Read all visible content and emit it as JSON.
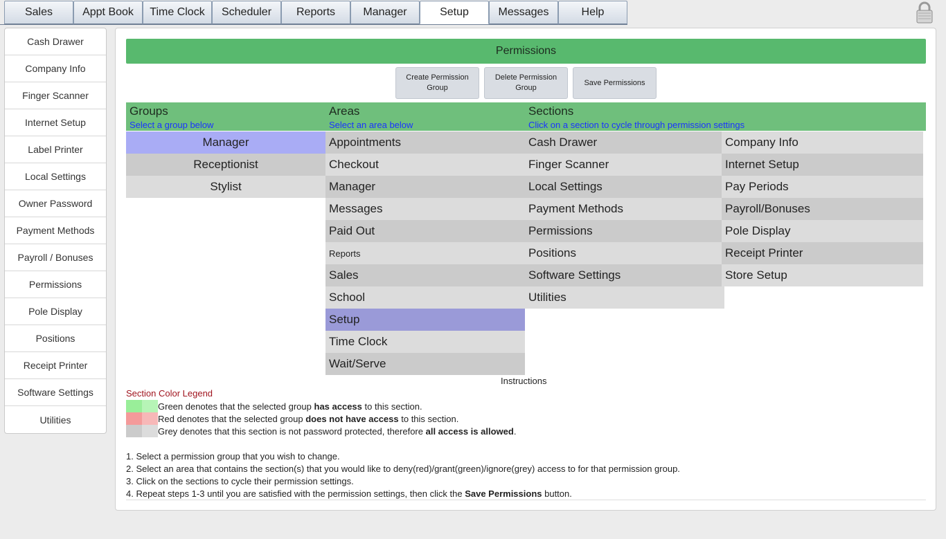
{
  "top_tabs": [
    "Sales",
    "Appt Book",
    "Time Clock",
    "Scheduler",
    "Reports",
    "Manager",
    "Setup",
    "Messages",
    "Help"
  ],
  "active_tab": "Setup",
  "sidebar": [
    "Cash Drawer",
    "Company Info",
    "Finger Scanner",
    "Internet Setup",
    "Label Printer",
    "Local Settings",
    "Owner Password",
    "Payment Methods",
    "Payroll / Bonuses",
    "Permissions",
    "Pole Display",
    "Positions",
    "Receipt Printer",
    "Software Settings",
    "Utilities"
  ],
  "header": {
    "title": "Permissions"
  },
  "buttons": {
    "create": "Create Permission Group",
    "delete": "Delete Permission Group",
    "save": "Save Permissions"
  },
  "columns": {
    "groups_title": "Groups",
    "groups_sub": "Select a group below",
    "areas_title": "Areas",
    "areas_sub": "Select an area below",
    "sections_title": "Sections",
    "sections_sub": "Click on a section to cycle through permission settings"
  },
  "groups": [
    "Manager",
    "Receptionist",
    "Stylist"
  ],
  "selected_group": "Manager",
  "areas": [
    "Appointments",
    "Checkout",
    "Manager",
    "Messages",
    "Paid Out",
    "Reports",
    "Sales",
    "School",
    "Setup",
    "Time Clock",
    "Wait/Serve"
  ],
  "selected_area": "Setup",
  "sections_left": [
    "Cash Drawer",
    "Finger Scanner",
    "Local Settings",
    "Payment Methods",
    "Permissions",
    "Positions",
    "Software Settings",
    "Utilities"
  ],
  "sections_right": [
    "Company Info",
    "Internet Setup",
    "Pay Periods",
    "Payroll/Bonuses",
    "Pole Display",
    "Receipt Printer",
    "Store Setup"
  ],
  "instructions_label": "Instructions",
  "legend": {
    "title": "Section Color Legend",
    "green": {
      "pre": "Green denotes that the selected group ",
      "bold": "has access",
      "post": " to this section.",
      "colors": [
        "#99ee99",
        "#b6f4b6"
      ]
    },
    "red": {
      "pre": "Red denotes that the selected group ",
      "bold": "does not have access",
      "post": " to this section.",
      "colors": [
        "#f49a9a",
        "#f7b8b8"
      ]
    },
    "grey": {
      "pre": "Grey denotes that this section is not password protected, therefore ",
      "bold": "all access is allowed",
      "post": ".",
      "colors": [
        "#cbcbcb",
        "#dcdcdc"
      ]
    }
  },
  "steps": [
    {
      "text": "1. Select a permission group that you wish to change."
    },
    {
      "text": "2. Select an area that contains the section(s) that you would like to deny(red)/grant(green)/ignore(grey) access to for that permission group."
    },
    {
      "text": "3. Click on the sections to cycle their permission settings."
    },
    {
      "pre": "4. Repeat steps 1-3 until you are satisfied with the permission settings, then click the ",
      "bold": "Save Permissions",
      "post": " button."
    }
  ]
}
